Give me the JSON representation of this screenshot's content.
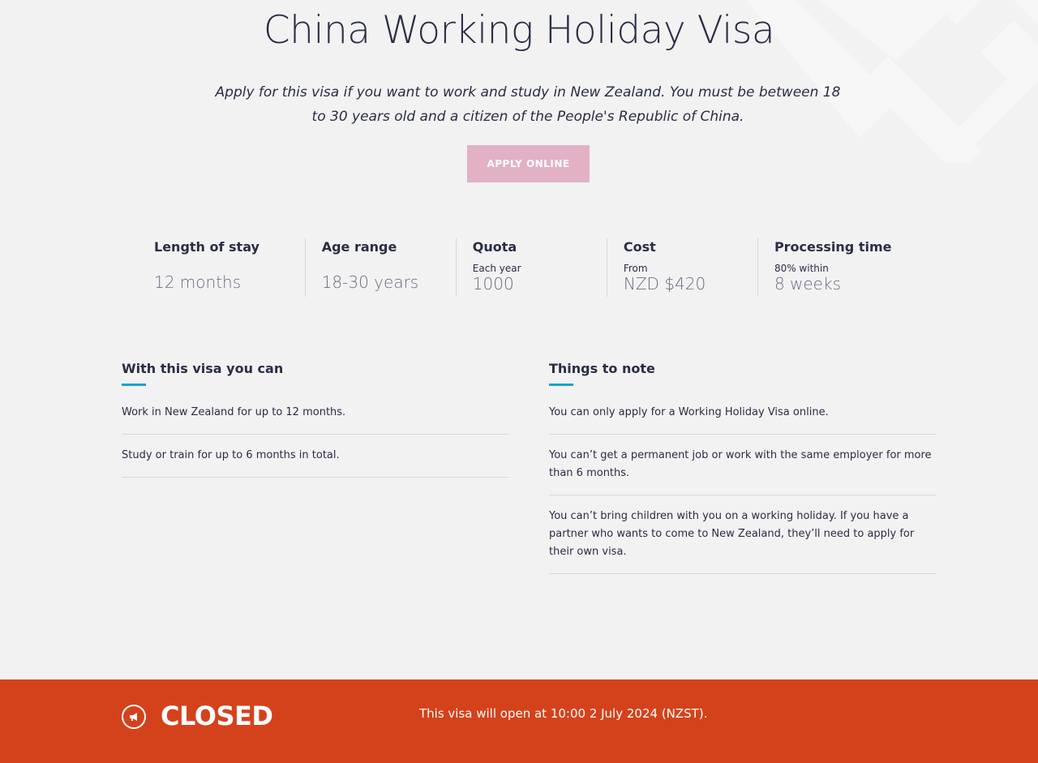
{
  "page": {
    "title": "China Working Holiday Visa",
    "intro": "Apply for this visa if you want to work and study in New Zealand. You must be between 18 to 30 years old and a citizen of the People's Republic of China.",
    "apply_label": "APPLY ONLINE"
  },
  "stats": [
    {
      "label": "Length of stay",
      "sub": "",
      "value": "12 months"
    },
    {
      "label": "Age range",
      "sub": "",
      "value": "18-30 years"
    },
    {
      "label": "Quota",
      "sub": "Each year",
      "value": "1000"
    },
    {
      "label": "Cost",
      "sub": "From",
      "value": "NZD $420"
    },
    {
      "label": "Processing time",
      "sub": "80% within",
      "value": "8 weeks"
    }
  ],
  "can": {
    "heading": "With this visa you can",
    "items": [
      "Work in New Zealand for up to 12 months.",
      "Study or train for up to 6 months in total."
    ]
  },
  "notes": {
    "heading": "Things to note",
    "items": [
      "You can only apply for a Working Holiday Visa online.",
      "You can’t get a permanent job or work with the same employer for more than 6 months.",
      "You can’t bring children with you on a working holiday. If you have a partner who wants to come to New Zealand, they’ll need to apply for their own visa."
    ]
  },
  "status": {
    "icon": "megaphone-icon",
    "label": "CLOSED",
    "message": "This visa will open at 10:00 2 July 2024 (NZST)."
  },
  "colors": {
    "background": "#f2f2f2",
    "apply_button": "#e2b1c6",
    "accent": "#1aa3c8",
    "closed_banner": "#d4421c",
    "text": "#2a2d45"
  }
}
